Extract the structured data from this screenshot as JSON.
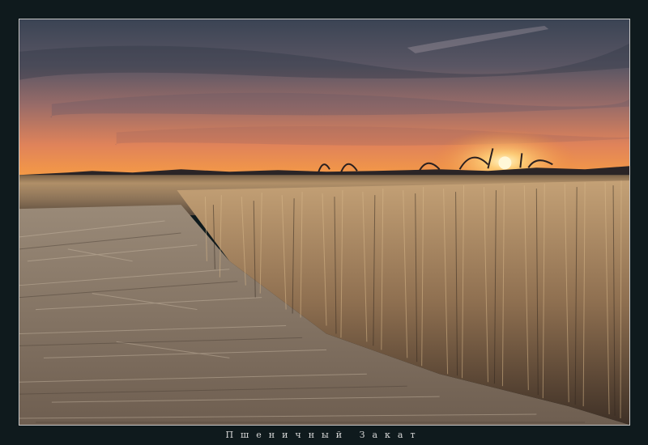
{
  "photo": {
    "scene": "wheat-field-sunset",
    "colors": {
      "sky_top": "#3d4656",
      "sky_mid": "#8a6a6a",
      "sky_horizon": "#f08a3a",
      "sun": "#fff4c0",
      "wheat_light": "#c9a77a",
      "wheat_dark": "#4a3a2c",
      "ground": "#8a7866"
    }
  },
  "caption": {
    "title": "Пшеничный Закат"
  }
}
